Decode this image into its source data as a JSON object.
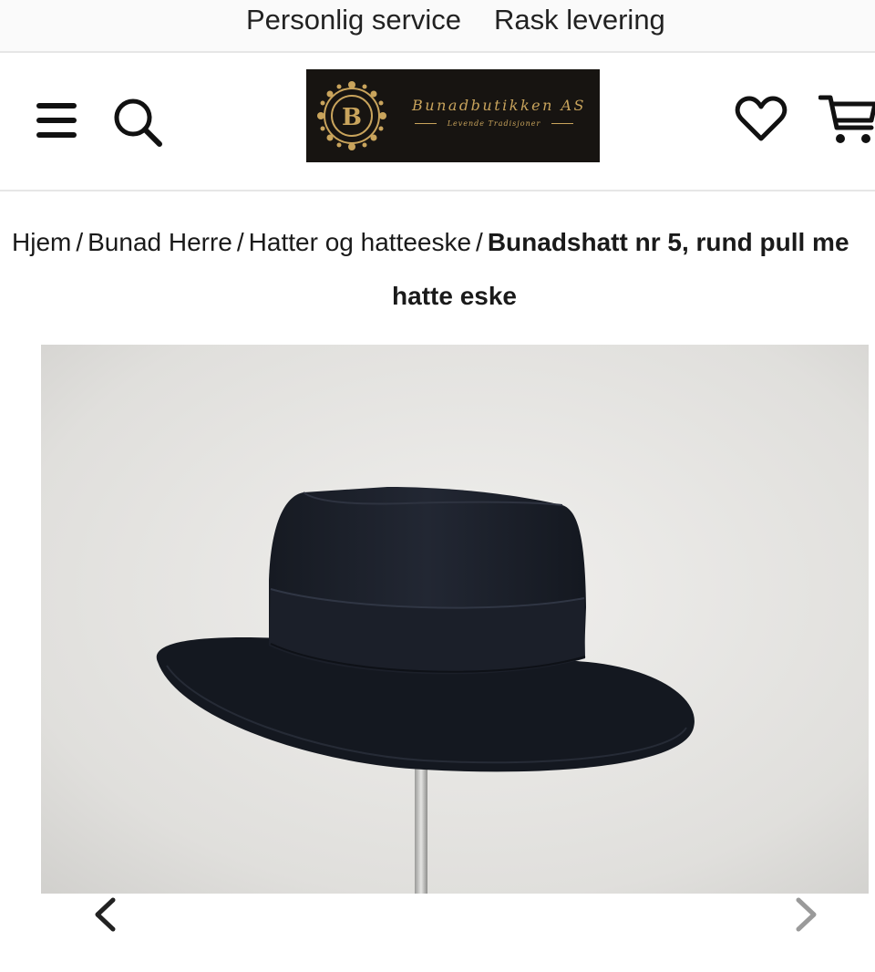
{
  "topbar": {
    "items": [
      "Personlig service",
      "Rask levering"
    ]
  },
  "header": {
    "menu_icon": "hamburger-menu-icon",
    "search_icon": "search-icon",
    "wishlist_icon": "heart-icon",
    "cart_icon": "cart-icon",
    "logo": {
      "brand": "Bunadbutikken AS",
      "tagline": "Levende Tradisjoner",
      "monogram": "B"
    }
  },
  "breadcrumb": {
    "items": [
      "Hjem",
      "Bunad Herre",
      "Hatter og hatteeske"
    ],
    "separator": "/",
    "current": "Bunadshatt nr 5, rund pull me",
    "current_continued": "hatte eske"
  },
  "gallery": {
    "prev_icon": "chevron-left-icon",
    "next_icon": "chevron-right-icon"
  },
  "colors": {
    "logo_bg": "#171411",
    "logo_gold": "#c9a45c",
    "hat": "#1b1f29"
  }
}
